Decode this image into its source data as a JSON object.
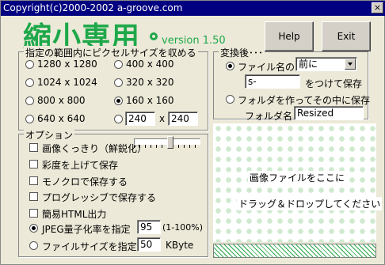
{
  "window": {
    "title": "Copyright(c)2000-2002 a-groove.com",
    "close_label": "×"
  },
  "logo": {
    "text": "縮小専用",
    "version": "version 1.50"
  },
  "buttons": {
    "help": "Help",
    "exit": "Exit"
  },
  "size_group": {
    "legend": "指定の範囲内にピクセルサイズを収める",
    "options": [
      {
        "label": "1280 x 1280",
        "selected": false
      },
      {
        "label": "400 x 400",
        "selected": false
      },
      {
        "label": "1024 x 1024",
        "selected": false
      },
      {
        "label": "320 x 320",
        "selected": false
      },
      {
        "label": "800 x 800",
        "selected": false
      },
      {
        "label": "160 x 160",
        "selected": true
      },
      {
        "label": "640 x 640",
        "selected": false
      }
    ],
    "custom_width": "240",
    "custom_sep": "x",
    "custom_height": "240"
  },
  "convert_group": {
    "legend": "変換後･･･",
    "filename_label": "ファイル名の",
    "position_value": "前に",
    "prefix_value": "s-",
    "suffix_label": "をつけて保存",
    "folder_option": "フォルダを作ってその中に保存",
    "folder_name_label": "フォルダ名",
    "folder_name_value": "Resized"
  },
  "options_group": {
    "legend": "オプション",
    "sharpen": "画像くっきり（鮮鋭化）",
    "saturation": "彩度を上げて保存",
    "mono": "モノクロで保存する",
    "progressive": "プログレッシブで保存する",
    "html": "簡易HTML出力",
    "jpeg_quality": "JPEG量子化率を指定",
    "jpeg_value": "95",
    "jpeg_range": "(1-100%)",
    "filesize": "ファイルサイズを指定",
    "filesize_value": "50",
    "filesize_unit": "KByte"
  },
  "drop_zone": {
    "line1": "画像ファイルをここに",
    "line2": "ドラッグ＆ドロップしてください"
  }
}
